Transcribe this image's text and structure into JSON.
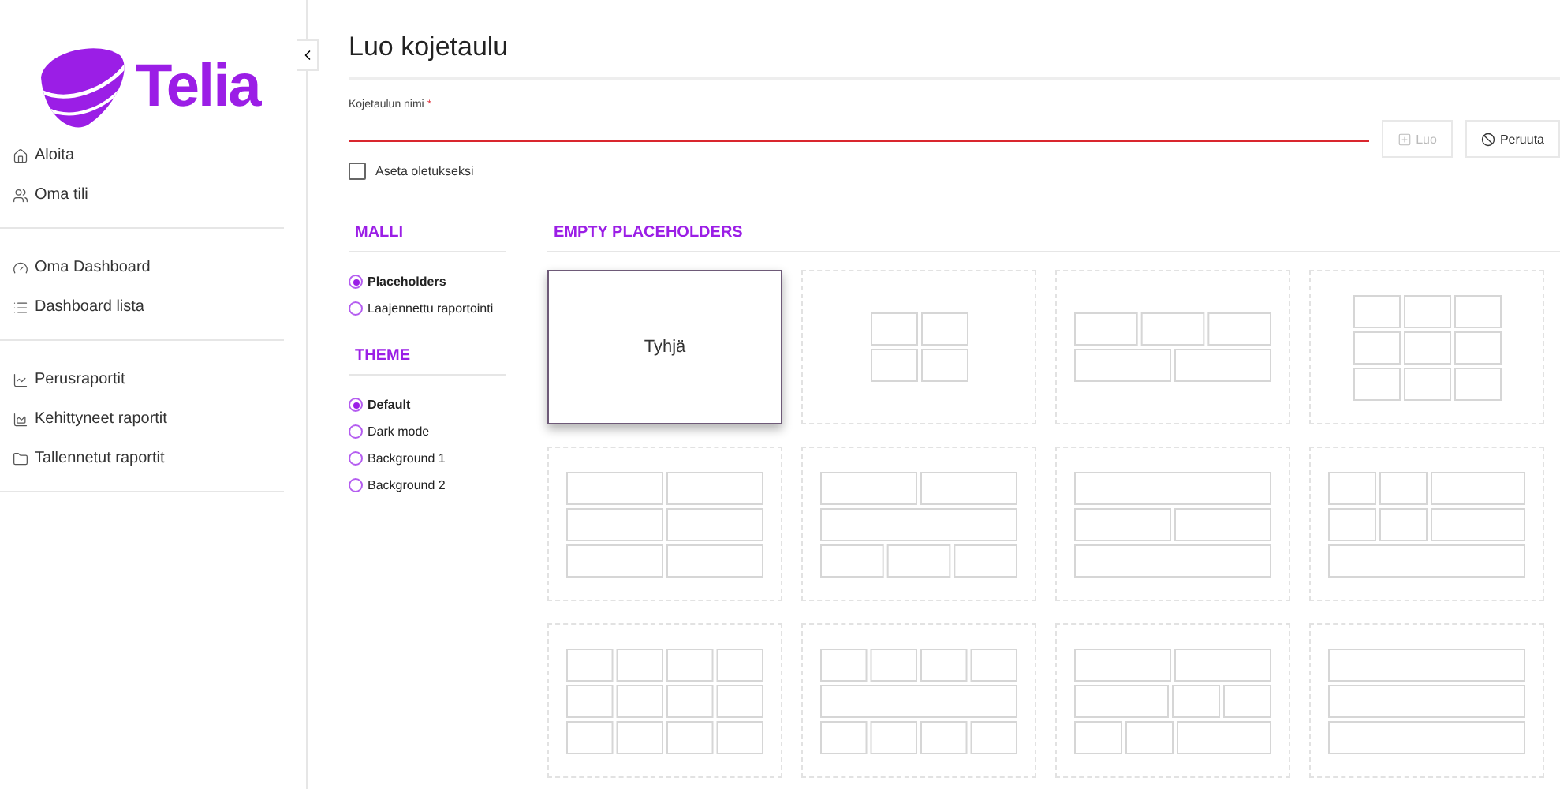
{
  "brand": {
    "name": "Telia"
  },
  "sidebar": {
    "groups": [
      {
        "items": [
          {
            "label": "Aloita"
          },
          {
            "label": "Oma tili"
          }
        ]
      },
      {
        "items": [
          {
            "label": "Oma Dashboard"
          },
          {
            "label": "Dashboard lista"
          }
        ]
      },
      {
        "items": [
          {
            "label": "Perusraportit"
          },
          {
            "label": "Kehittyneet raportit"
          },
          {
            "label": "Tallennetut raportit"
          }
        ]
      }
    ]
  },
  "page": {
    "title": "Luo kojetaulu"
  },
  "form": {
    "name_label": "Kojetaulun nimi",
    "required_mark": "*",
    "invalid": true,
    "default_checkbox": {
      "label": "Aseta oletukseksi",
      "checked": false
    },
    "buttons": [
      {
        "label": "Luo",
        "kind": "create",
        "disabled": true
      },
      {
        "label": "Peruuta",
        "kind": "cancel",
        "disabled": false
      }
    ]
  },
  "model": {
    "heading": "MALLI",
    "options": [
      {
        "label": "Placeholders",
        "selected": true
      },
      {
        "label": "Laajennettu raportointi",
        "selected": false
      }
    ]
  },
  "theme": {
    "heading": "THEME",
    "options": [
      {
        "label": "Default",
        "selected": true
      },
      {
        "label": "Dark mode",
        "selected": false
      },
      {
        "label": "Background 1",
        "selected": false
      },
      {
        "label": "Background 2",
        "selected": false
      }
    ]
  },
  "templates": {
    "heading": "EMPTY PLACEHOLDERS",
    "items": [
      {
        "label": "Tyhjä",
        "selected": true
      },
      {
        "selected": false
      },
      {
        "selected": false
      },
      {
        "selected": false
      },
      {
        "selected": false
      },
      {
        "selected": false
      },
      {
        "selected": false
      },
      {
        "selected": false
      },
      {
        "selected": false
      },
      {
        "selected": false
      },
      {
        "selected": false
      },
      {
        "selected": false
      }
    ]
  }
}
